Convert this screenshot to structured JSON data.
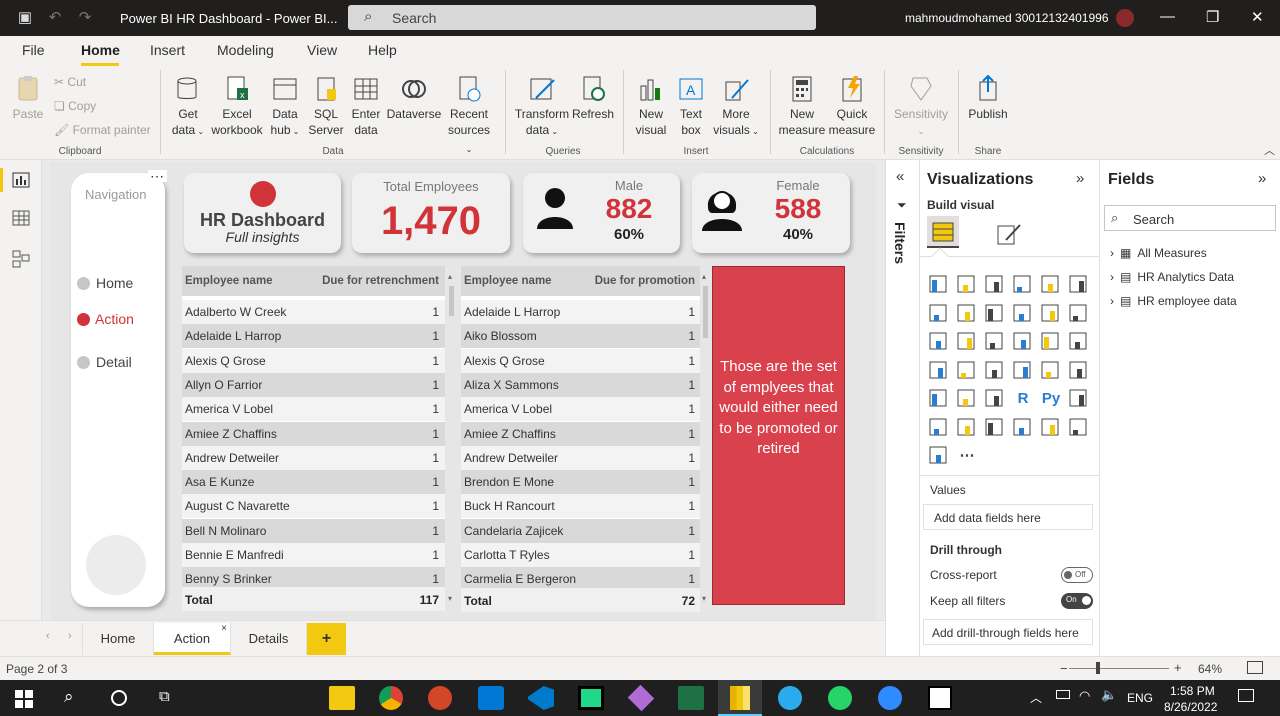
{
  "window": {
    "title": "Power BI HR Dashboard - Power BI...",
    "search_placeholder": "Search",
    "user": "mahmoudmohamed 30012132401996"
  },
  "menu": [
    "File",
    "Home",
    "Insert",
    "Modeling",
    "View",
    "Help"
  ],
  "ribbon": {
    "clipboard": {
      "paste": "Paste",
      "cut": "Cut",
      "copy": "Copy",
      "format_painter": "Format painter",
      "group": "Clipboard"
    },
    "data": {
      "get_data_1": "Get",
      "get_data_2": "data",
      "excel_1": "Excel",
      "excel_2": "workbook",
      "hub_1": "Data",
      "hub_2": "hub",
      "sql_1": "SQL",
      "sql_2": "Server",
      "enter_1": "Enter",
      "enter_2": "data",
      "dataverse": "Dataverse",
      "recent_1": "Recent",
      "recent_2": "sources",
      "group": "Data"
    },
    "queries": {
      "transform_1": "Transform",
      "transform_2": "data",
      "refresh": "Refresh",
      "group": "Queries"
    },
    "insert": {
      "new_visual_1": "New",
      "new_visual_2": "visual",
      "text_box_1": "Text",
      "text_box_2": "box",
      "more_visuals_1": "More",
      "more_visuals_2": "visuals",
      "group": "Insert"
    },
    "calculations": {
      "new_measure_1": "New",
      "new_measure_2": "measure",
      "quick_measure_1": "Quick",
      "quick_measure_2": "measure",
      "group": "Calculations"
    },
    "sensitivity": {
      "label": "Sensitivity",
      "group": "Sensitivity"
    },
    "share": {
      "publish": "Publish",
      "group": "Share"
    }
  },
  "report": {
    "nav": {
      "title": "Navigation",
      "items": [
        "Home",
        "Action",
        "Detail"
      ],
      "active": "Action",
      "active_color": "#d13438"
    },
    "hr_card": {
      "title": "HR Dashboard",
      "subtitle": "Full insights"
    },
    "total_card": {
      "label": "Total Employees",
      "value": "1,470"
    },
    "male_card": {
      "label": "Male",
      "value": "882",
      "pct": "60%"
    },
    "female_card": {
      "label": "Female",
      "value": "588",
      "pct": "40%"
    },
    "retrench_table": {
      "col1": "Employee name",
      "col2": "Due for retrenchment",
      "rows": [
        [
          "Adalberto W Creek",
          "1"
        ],
        [
          "Adelaide L Harrop",
          "1"
        ],
        [
          "Alexis Q Grose",
          "1"
        ],
        [
          "Allyn O Farrior",
          "1"
        ],
        [
          "America V Lobel",
          "1"
        ],
        [
          "Amiee Z Chaffins",
          "1"
        ],
        [
          "Andrew Detweiler",
          "1"
        ],
        [
          "Asa E Kunze",
          "1"
        ],
        [
          "August C Navarette",
          "1"
        ],
        [
          "Bell N Molinaro",
          "1"
        ],
        [
          "Bennie E Manfredi",
          "1"
        ],
        [
          "Benny S Brinker",
          "1"
        ]
      ],
      "total_label": "Total",
      "total_value": "117"
    },
    "promotion_table": {
      "col1": "Employee name",
      "col2": "Due for promotion",
      "rows": [
        [
          "Adelaide L Harrop",
          "1"
        ],
        [
          "Aiko Blossom",
          "1"
        ],
        [
          "Alexis Q Grose",
          "1"
        ],
        [
          "Aliza X Sammons",
          "1"
        ],
        [
          "America V Lobel",
          "1"
        ],
        [
          "Amiee Z Chaffins",
          "1"
        ],
        [
          "Andrew Detweiler",
          "1"
        ],
        [
          "Brendon E Mone",
          "1"
        ],
        [
          "Buck H Rancourt",
          "1"
        ],
        [
          "Candelaria Zajicek",
          "1"
        ],
        [
          "Carlotta T Ryles",
          "1"
        ],
        [
          "Carmelia E Bergeron",
          "1"
        ]
      ],
      "total_label": "Total",
      "total_value": "72"
    },
    "note": "Those are the set of emplyees that would either need to be promoted or retired",
    "accent_color": "#d13438"
  },
  "page_tabs": [
    "Home",
    "Action",
    "Details"
  ],
  "active_page_tab": "Action",
  "add_page": "+",
  "filters_label": "Filters",
  "viz_pane": {
    "title": "Visualizations",
    "build": "Build visual",
    "values": "Values",
    "add_fields": "Add data fields here",
    "drill": "Drill through",
    "cross_report": "Cross-report",
    "cross_report_state": "Off",
    "keep_filters": "Keep all filters",
    "keep_filters_state": "On",
    "add_drill": "Add drill-through fields here"
  },
  "fields_pane": {
    "title": "Fields",
    "search_placeholder": "Search",
    "tables": [
      "All Measures",
      "HR Analytics Data",
      "HR employee data"
    ]
  },
  "status": {
    "page": "Page 2 of 3",
    "zoom": "64%"
  },
  "taskbar": {
    "lang": "ENG",
    "time": "1:58 PM",
    "date": "8/26/2022"
  }
}
